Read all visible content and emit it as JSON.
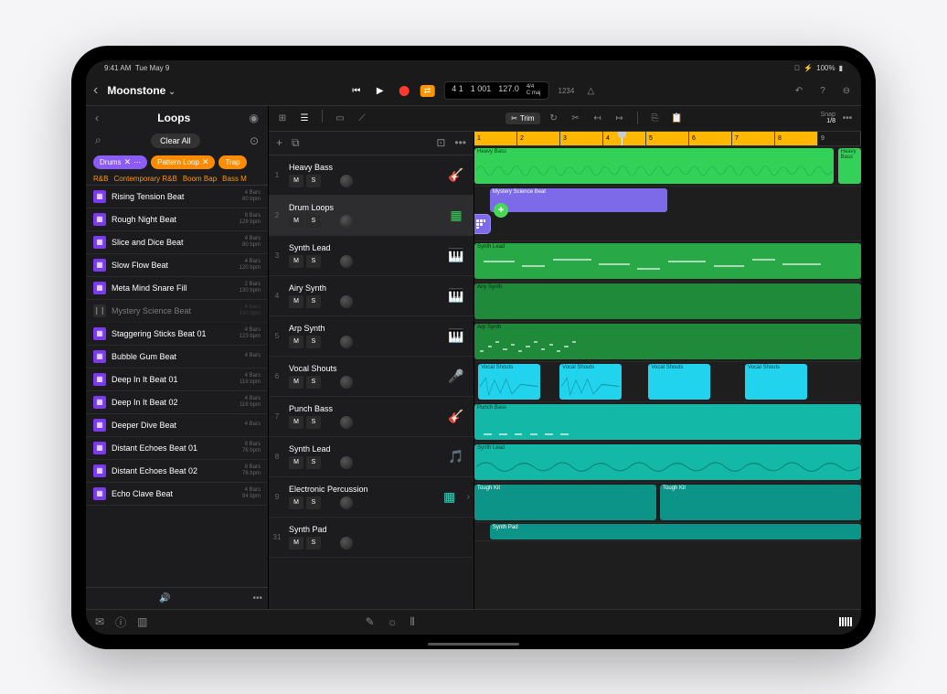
{
  "status": {
    "time": "9:41 AM",
    "date": "Tue May 9",
    "battery": "100%"
  },
  "project": {
    "name": "Moonstone"
  },
  "transport": {
    "bar": "4 1",
    "beat": "1 001",
    "tempo": "127.0",
    "sig": "4/4",
    "key": "C maj",
    "tuning": "1234"
  },
  "sidebar": {
    "title": "Loops",
    "clear": "Clear All",
    "tags": [
      {
        "label": "Drums",
        "style": "purple",
        "x": true,
        "dots": true
      },
      {
        "label": "Pattern Loop",
        "style": "orange",
        "x": true
      },
      {
        "label": "Trap",
        "style": "orange",
        "x": false
      }
    ],
    "subtags": [
      "R&B",
      "Contemporary R&B",
      "Boom Bap",
      "Bass M"
    ],
    "loops": [
      {
        "name": "Rising Tension Beat",
        "bars": "4 Bars",
        "bpm": "80 bpm"
      },
      {
        "name": "Rough Night Beat",
        "bars": "8 Bars",
        "bpm": "128 bpm"
      },
      {
        "name": "Slice and Dice Beat",
        "bars": "4 Bars",
        "bpm": "80 bpm"
      },
      {
        "name": "Slow Flow Beat",
        "bars": "4 Bars",
        "bpm": "120 bpm"
      },
      {
        "name": "Meta Mind Snare Fill",
        "bars": "2 Bars",
        "bpm": "130 bpm"
      },
      {
        "name": "Mystery Science Beat",
        "bars": "4 Bars",
        "bpm": "130 bpm",
        "mystery": true
      },
      {
        "name": "Staggering Sticks Beat 01",
        "bars": "4 Bars",
        "bpm": "123 bpm"
      },
      {
        "name": "Bubble Gum Beat",
        "bars": "4 Bars",
        "bpm": ""
      },
      {
        "name": "Deep In It Beat 01",
        "bars": "4 Bars",
        "bpm": "116 bpm"
      },
      {
        "name": "Deep In It Beat 02",
        "bars": "4 Bars",
        "bpm": "116 bpm"
      },
      {
        "name": "Deeper Dive Beat",
        "bars": "4 Bars",
        "bpm": ""
      },
      {
        "name": "Distant Echoes Beat 01",
        "bars": "8 Bars",
        "bpm": "76 bpm"
      },
      {
        "name": "Distant Echoes Beat 02",
        "bars": "8 Bars",
        "bpm": "76 bpm"
      },
      {
        "name": "Echo Clave Beat",
        "bars": "4 Bars",
        "bpm": "84 bpm"
      }
    ]
  },
  "tracks": [
    {
      "n": "1",
      "name": "Heavy Bass",
      "color": "green",
      "icon": "guitar"
    },
    {
      "n": "2",
      "name": "Drum Loops",
      "color": "green",
      "icon": "drum-machine",
      "selected": true
    },
    {
      "n": "3",
      "name": "Synth Lead",
      "color": "green",
      "icon": "keys"
    },
    {
      "n": "4",
      "name": "Airy Synth",
      "color": "green",
      "icon": "keys"
    },
    {
      "n": "5",
      "name": "Arp Synth",
      "color": "green",
      "icon": "keys"
    },
    {
      "n": "6",
      "name": "Vocal Shouts",
      "color": "teal",
      "icon": "mic"
    },
    {
      "n": "7",
      "name": "Punch Bass",
      "color": "teal",
      "icon": "guitar"
    },
    {
      "n": "8",
      "name": "Synth Lead",
      "color": "teal",
      "icon": "band"
    },
    {
      "n": "9",
      "name": "Electronic Percussion",
      "color": "teal",
      "icon": "drum-machine",
      "chev": true
    },
    {
      "n": "31",
      "name": "Synth Pad",
      "color": "teal",
      "icon": ""
    }
  ],
  "mute": "M",
  "solo": "S",
  "toolbar": {
    "trim": "Trim",
    "snap": "Snap",
    "snapval": "1/8"
  },
  "ruler": [
    "1",
    "2",
    "3",
    "4",
    "5",
    "6",
    "7",
    "8",
    "9"
  ],
  "regions": {
    "heavyBass": "Heavy Bass",
    "mystery": "Mystery Science Beat",
    "synthLead": "Synth Lead",
    "airySynth": "Airy Synth",
    "arpSynth": "Arp Synth",
    "vocalShouts": "Vocal Shouts",
    "punchBass": "Punch Bass",
    "toughKit": "Tough Kit",
    "synthPad": "Synth Pad"
  }
}
